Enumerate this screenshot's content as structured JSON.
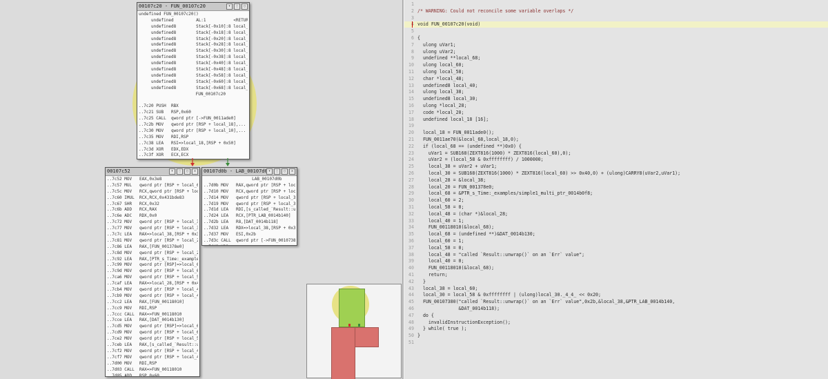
{
  "graph": {
    "block_main": {
      "title": "00107c20 - FUN_00107c20",
      "lines": [
        "undefined FUN_00107c20()",
        "     undefined         AL:1           <RETURN>",
        "     undefined8        Stack[-0x10]:8 local_10",
        "     undefined8        Stack[-0x18]:8 local_18",
        "     undefined8        Stack[-0x20]:8 local_20",
        "     undefined8        Stack[-0x28]:8 local_28",
        "     undefined8        Stack[-0x30]:8 local_30",
        "     undefined8        Stack[-0x38]:8 local_38",
        "     undefined8        Stack[-0x40]:8 local_40",
        "     undefined8        Stack[-0x48]:8 local_48",
        "     undefined8        Stack[-0x58]:8 local_58",
        "     undefined8        Stack[-0x60]:8 local_60",
        "     undefined8        Stack[-0x68]:8 local_68",
        "              FUN_00107c20",
        "",
        "..7c20 PUSH  RBX",
        "..7c21 SUB   RSP,0x60",
        "..7c25 CALL  qword ptr [->FUN_0011ade0]",
        "..7c2b MOV   qword ptr [RSP + local_18],...",
        "..7c30 MOV   qword ptr [RSP + local_10],...",
        "..7c35 MOV   RDI,RSP",
        "..7c38 LEA   RSI=>local_18,[RSP + 0x50]",
        "..7c3d XOR   EDX,EDX",
        "..7c3f XOR   ECX,ECX",
        "..7c41 CALL  qword ptr [->FUN_0011ae70]",
        "..7c47 CMP   qword ptr [RSP]=>local_68,...",
        "..7c4c JNZ   LAB_00107d0b"
      ]
    },
    "block_left": {
      "title": "00107c52",
      "lines": [
        "..7c52 MOV   EAX,0x3e8",
        "..7c57 MUL   qword ptr [RSP + local_60]",
        "..7c5c MOV   RCX,qword ptr [RSP + local...",
        "..7c60 IMUL  RCX,RCX,0x431bde83",
        "..7c67 SHR   RCX,0x32",
        "..7c6b ADD   RCX,RAX",
        "..7c6e ADC   RDX,0x0",
        "..7c72 MOV   qword ptr [RSP + local_38],...",
        "..7c77 MOV   qword ptr [RSP + local_30],...",
        "..7c7c LEA   RAX=>local_38,[RSP + 0x30]",
        "..7c81 MOV   qword ptr [RSP + local_28],...",
        "..7c86 LEA   RAX,[FUN_001378e0]",
        "..7c8d MOV   qword ptr [RSP + local_20],...",
        "..7c92 LEA   RAX,[PTR_s_Time:_examples/...",
        "..7c99 MOV   qword ptr [RSP]=>local_68,...",
        "..7c9d MOV   qword ptr [RSP + local_60],...",
        "..7ca6 MOV   qword ptr [RSP + local_58],...",
        "..7caf LEA   RAX=>local_28,[RSP + 0x40]",
        "..7cb4 MOV   qword ptr [RSP + local_48],...",
        "..7cb9 MOV   qword ptr [RSP + local_40],...",
        "..7cc2 LEA   RAX,[FUN_00118010]",
        "..7cc9 MOV   RDI,RSP",
        "..7ccc CALL  RAX=>FUN_00118010",
        "..7cce LEA   RAX,[DAT_0014b130]",
        "..7cd5 MOV   qword ptr [RSP]=>local_68,...",
        "..7cd9 MOV   qword ptr [RSP + local_60],...",
        "..7ce2 MOV   qword ptr [RSP + local_58],...",
        "..7ceb LEA   RAX,[s_called_`Result::unw...",
        "..7cf2 MOV   qword ptr [RSP + local_48],...",
        "..7cf7 MOV   qword ptr [RSP + local_40],...",
        "..7d00 MOV   RDI,RSP",
        "..7d03 CALL  RAX=>FUN_00118010",
        "..7d05 ADD   RSP,0x60",
        "..7d09 POP   RBX",
        "..7d0a RET"
      ]
    },
    "block_right": {
      "title": "00107d0b - LAB_00107d0b",
      "lines": [
        "              LAB_00107d0b",
        "..7d0b MOV   RAX,qword ptr [RSP + local...",
        "..7d10 MOV   RCX,qword ptr [RSP + local...",
        "..7d14 MOV   qword ptr [RSP + local_38],...",
        "..7d19 MOV   qword ptr [RSP + local_30],...",
        "..7d1d LEA   RDI,[s_called_`Result::unw...",
        "..7d24 LEA   RCX,[PTR_LAB_0014b140]",
        "..7d2b LEA   R8,[DAT_0014b118]",
        "..7d32 LEA   RDX=>local_38,[RSP + 0x30]",
        "..7d37 MOV   ESI,0x2b",
        "..7d3c CALL  qword ptr [->FUN_00107380]",
        "..7d42 UD2"
      ]
    },
    "buttons": [
      "▾",
      "⬚",
      "▢",
      "✕"
    ]
  },
  "decompiler": {
    "lines": [
      "",
      "/* WARNING: Could not reconcile some variable overlaps */",
      "",
      "void FUN_00107c20(void)",
      "",
      "{",
      "  ulong uVar1;",
      "  ulong uVar2;",
      "  undefined **local_68;",
      "  ulong local_60;",
      "  ulong local_58;",
      "  char *local_48;",
      "  undefined8 local_40;",
      "  ulong local_38;",
      "  undefined8 local_30;",
      "  ulong *local_28;",
      "  code *local_20;",
      "  undefined local_18 [16];",
      "",
      "  local_18 = FUN_0011ade0();",
      "  FUN_0011ae70(&local_68,local_18,0);",
      "  if (local_68 == (undefined **)0x0) {",
      "    uVar1 = SUB168(ZEXT816(1000) * ZEXT816(local_60),0);",
      "    uVar2 = (local_58 & 0xffffffff) / 1000000;",
      "    local_38 = uVar2 + uVar1;",
      "    local_30 = SUB168(ZEXT816(1000) * ZEXT816(local_60) >> 0x40,0) + (ulong)CARRY8(uVar2,uVar1);",
      "    local_28 = &local_38;",
      "    local_20 = FUN_001378e0;",
      "    local_68 = &PTR_s_Time:_examples/simple1_multi_ptr_0014b0f8;",
      "    local_60 = 2;",
      "    local_58 = 0;",
      "    local_48 = (char *)&local_28;",
      "    local_40 = 1;",
      "    FUN_00118010(&local_68);",
      "    local_68 = (undefined **)&DAT_0014b130;",
      "    local_60 = 1;",
      "    local_58 = 0;",
      "    local_48 = \"called `Result::unwrap()` on an `Err` value\";",
      "    local_40 = 0;",
      "    FUN_00118010(&local_68);",
      "    return;",
      "  }",
      "  local_38 = local_60;",
      "  local_30 = local_58 & 0xffffffff | (ulong)local_30._4_4_ << 0x20;",
      "  FUN_00107380(\"called `Result::unwrap()` on an `Err` value\",0x2b,&local_38,&PTR_LAB_0014b140,",
      "               &DAT_0014b118);",
      "  do {",
      "    invalidInstructionException();",
      "  } while( true );",
      "}",
      ""
    ]
  },
  "colors": {
    "highlight": "#e6e07a",
    "minimap_green": "#9fd052",
    "minimap_red": "#d9726e",
    "edge_red": "#d03030",
    "edge_green": "#3a8a3a"
  }
}
